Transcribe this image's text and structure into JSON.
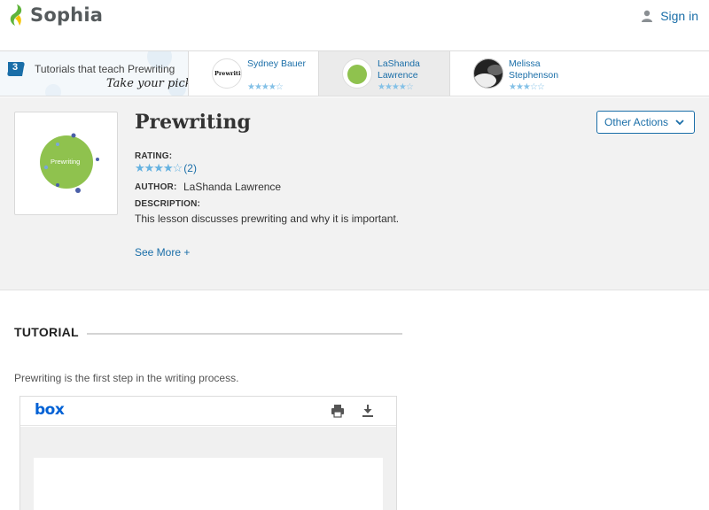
{
  "header": {
    "brand": "Sophia",
    "brand_color": "#5fb43b",
    "signin_label": "Sign in",
    "signin_icon": "person-icon"
  },
  "strip": {
    "count": "3",
    "intro": "Tutorials that teach Prewriting",
    "pick": "Take your pick:",
    "cards": [
      {
        "name": "Sydney Bauer",
        "thumb_text": "Prewriting",
        "stars": "★★★★☆",
        "rating": 4
      },
      {
        "name": "LaShanda Lawrence",
        "stars": "★★★★☆",
        "rating": 3.5
      },
      {
        "name": "Melissa Stephenson",
        "stars": "★★★☆☆",
        "rating": 2.5
      }
    ]
  },
  "lesson": {
    "title": "Prewriting",
    "thumb_text": "Prewriting",
    "rating_label": "RATING:",
    "stars": "★★★★☆",
    "rating_count": "(2)",
    "author_label": "AUTHOR:",
    "author": "LaShanda Lawrence",
    "description_label": "DESCRIPTION:",
    "description": "This lesson discusses prewriting and why it is important.",
    "see_more": "See More +",
    "other_actions": "Other Actions"
  },
  "tutorial": {
    "heading": "TUTORIAL",
    "intro": "Prewriting is the first step in the writing process.",
    "viewer_logo": "box",
    "print_icon": "print-icon",
    "download_icon": "download-icon"
  }
}
